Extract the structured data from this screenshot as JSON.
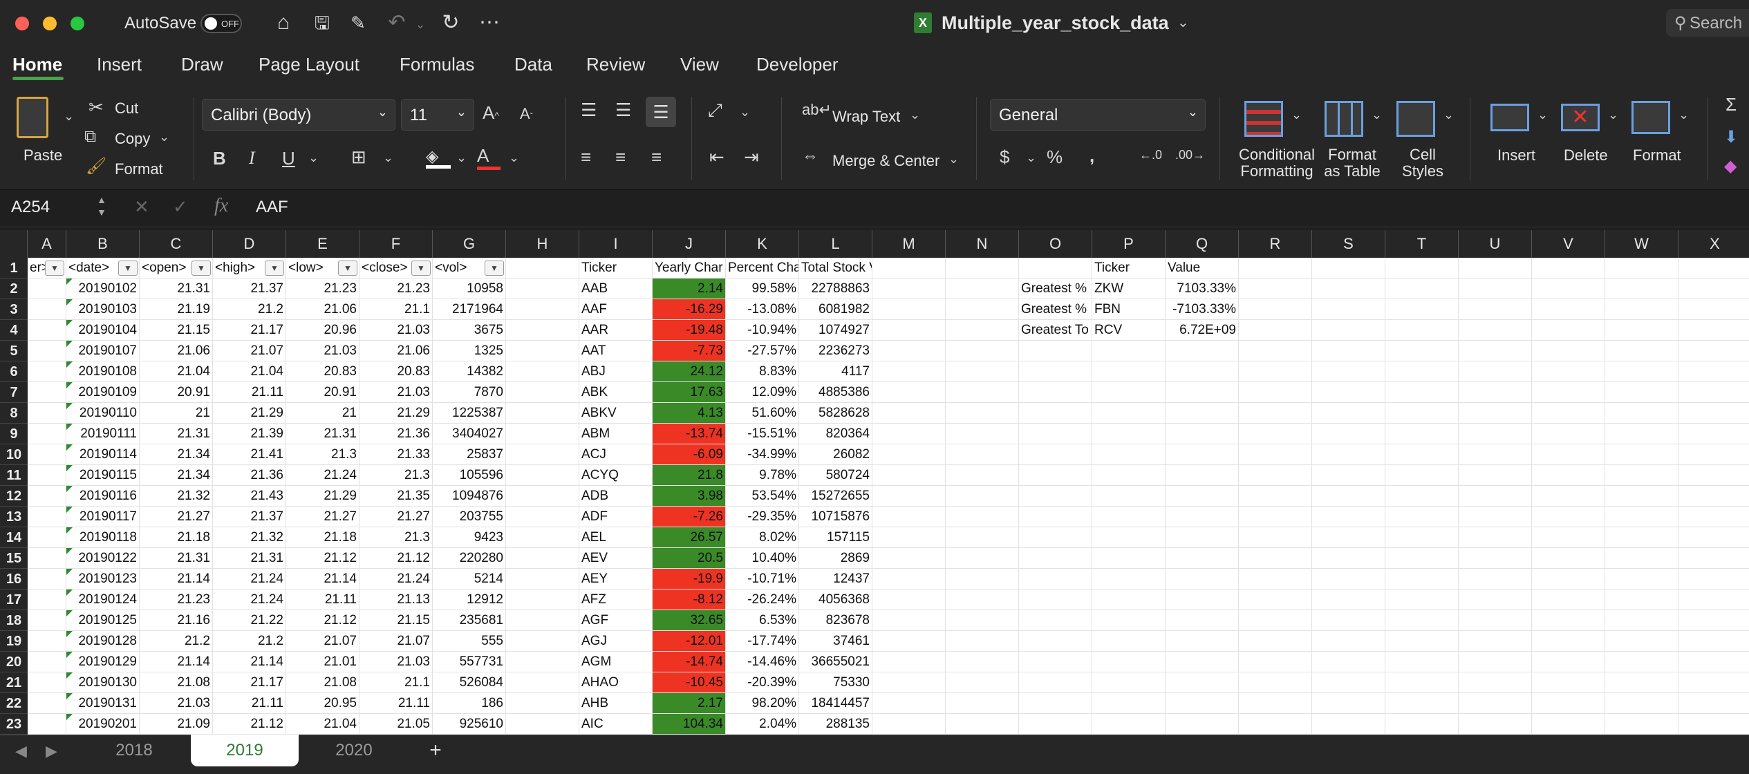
{
  "titlebar": {
    "autosave": "AutoSave",
    "toggle": "OFF",
    "doc_title": "Multiple_year_stock_data",
    "search": "Search",
    "icons": [
      "home-icon",
      "save-icon",
      "save-as-icon",
      "undo-icon",
      "redo-icon",
      "more-icon"
    ]
  },
  "tabs": [
    "Home",
    "Insert",
    "Draw",
    "Page Layout",
    "Formulas",
    "Data",
    "Review",
    "View",
    "Developer"
  ],
  "ribbon": {
    "paste": "Paste",
    "cut": "Cut",
    "copy": "Copy",
    "format": "Format",
    "font": "Calibri (Body)",
    "size": "11",
    "wrap": "Wrap Text",
    "merge": "Merge & Center",
    "numfmt": "General",
    "cond1": "Conditional",
    "cond2": "Formatting",
    "fat1": "Format",
    "fat2": "as Table",
    "cs1": "Cell",
    "cs2": "Styles",
    "insert": "Insert",
    "delete": "Delete",
    "fmt": "Format"
  },
  "formula": {
    "namebox": "A254",
    "fx": "fx",
    "value": "AAF"
  },
  "columns": [
    "A",
    "B",
    "C",
    "D",
    "E",
    "F",
    "G",
    "H",
    "I",
    "J",
    "K",
    "L",
    "M",
    "N",
    "O",
    "P",
    "Q",
    "R",
    "S",
    "T",
    "U",
    "V",
    "W",
    "X"
  ],
  "headers": {
    "A": "er>",
    "B": "<date>",
    "C": "<open>",
    "D": "<high>",
    "E": "<low>",
    "F": "<close>",
    "G": "<vol>",
    "I": "Ticker",
    "J": "Yearly Char",
    "K": "Percent Cha",
    "L": "Total Stock Volume",
    "P": "Ticker",
    "Q": "Value"
  },
  "rows": [
    {
      "b": "20190102",
      "c": "21.31",
      "d": "21.37",
      "e": "21.23",
      "f": "21.23",
      "g": "10958",
      "i": "AAB",
      "j": "2.14",
      "k": "99.58%",
      "l": "22788863",
      "o": "Greatest %",
      "p": "ZKW",
      "q": "7103.33%"
    },
    {
      "b": "20190103",
      "c": "21.19",
      "d": "21.2",
      "e": "21.06",
      "f": "21.1",
      "g": "2171964",
      "i": "AAF",
      "j": "-16.29",
      "k": "-13.08%",
      "l": "6081982",
      "o": "Greatest %",
      "p": "FBN",
      "q": "-7103.33%"
    },
    {
      "b": "20190104",
      "c": "21.15",
      "d": "21.17",
      "e": "20.96",
      "f": "21.03",
      "g": "3675",
      "i": "AAR",
      "j": "-19.48",
      "k": "-10.94%",
      "l": "1074927",
      "o": "Greatest To",
      "p": "RCV",
      "q": "6.72E+09"
    },
    {
      "b": "20190107",
      "c": "21.06",
      "d": "21.07",
      "e": "21.03",
      "f": "21.06",
      "g": "1325",
      "i": "AAT",
      "j": "-7.73",
      "k": "-27.57%",
      "l": "2236273"
    },
    {
      "b": "20190108",
      "c": "21.04",
      "d": "21.04",
      "e": "20.83",
      "f": "20.83",
      "g": "14382",
      "i": "ABJ",
      "j": "24.12",
      "k": "8.83%",
      "l": "4117"
    },
    {
      "b": "20190109",
      "c": "20.91",
      "d": "21.11",
      "e": "20.91",
      "f": "21.03",
      "g": "7870",
      "i": "ABK",
      "j": "17.63",
      "k": "12.09%",
      "l": "4885386"
    },
    {
      "b": "20190110",
      "c": "21",
      "d": "21.29",
      "e": "21",
      "f": "21.29",
      "g": "1225387",
      "i": "ABKV",
      "j": "4.13",
      "k": "51.60%",
      "l": "5828628"
    },
    {
      "b": "20190111",
      "c": "21.31",
      "d": "21.39",
      "e": "21.31",
      "f": "21.36",
      "g": "3404027",
      "i": "ABM",
      "j": "-13.74",
      "k": "-15.51%",
      "l": "820364"
    },
    {
      "b": "20190114",
      "c": "21.34",
      "d": "21.41",
      "e": "21.3",
      "f": "21.33",
      "g": "25837",
      "i": "ACJ",
      "j": "-6.09",
      "k": "-34.99%",
      "l": "26082"
    },
    {
      "b": "20190115",
      "c": "21.34",
      "d": "21.36",
      "e": "21.24",
      "f": "21.3",
      "g": "105596",
      "i": "ACYQ",
      "j": "21.8",
      "k": "9.78%",
      "l": "580724"
    },
    {
      "b": "20190116",
      "c": "21.32",
      "d": "21.43",
      "e": "21.29",
      "f": "21.35",
      "g": "1094876",
      "i": "ADB",
      "j": "3.98",
      "k": "53.54%",
      "l": "15272655"
    },
    {
      "b": "20190117",
      "c": "21.27",
      "d": "21.37",
      "e": "21.27",
      "f": "21.27",
      "g": "203755",
      "i": "ADF",
      "j": "-7.26",
      "k": "-29.35%",
      "l": "10715876"
    },
    {
      "b": "20190118",
      "c": "21.18",
      "d": "21.32",
      "e": "21.18",
      "f": "21.3",
      "g": "9423",
      "i": "AEL",
      "j": "26.57",
      "k": "8.02%",
      "l": "157115"
    },
    {
      "b": "20190122",
      "c": "21.31",
      "d": "21.31",
      "e": "21.12",
      "f": "21.12",
      "g": "220280",
      "i": "AEV",
      "j": "20.5",
      "k": "10.40%",
      "l": "2869"
    },
    {
      "b": "20190123",
      "c": "21.14",
      "d": "21.24",
      "e": "21.14",
      "f": "21.24",
      "g": "5214",
      "i": "AEY",
      "j": "-19.9",
      "k": "-10.71%",
      "l": "12437"
    },
    {
      "b": "20190124",
      "c": "21.23",
      "d": "21.24",
      "e": "21.11",
      "f": "21.13",
      "g": "12912",
      "i": "AFZ",
      "j": "-8.12",
      "k": "-26.24%",
      "l": "4056368"
    },
    {
      "b": "20190125",
      "c": "21.16",
      "d": "21.22",
      "e": "21.12",
      "f": "21.15",
      "g": "235681",
      "i": "AGF",
      "j": "32.65",
      "k": "6.53%",
      "l": "823678"
    },
    {
      "b": "20190128",
      "c": "21.2",
      "d": "21.2",
      "e": "21.07",
      "f": "21.07",
      "g": "555",
      "i": "AGJ",
      "j": "-12.01",
      "k": "-17.74%",
      "l": "37461"
    },
    {
      "b": "20190129",
      "c": "21.14",
      "d": "21.14",
      "e": "21.01",
      "f": "21.03",
      "g": "557731",
      "i": "AGM",
      "j": "-14.74",
      "k": "-14.46%",
      "l": "36655021"
    },
    {
      "b": "20190130",
      "c": "21.08",
      "d": "21.17",
      "e": "21.08",
      "f": "21.1",
      "g": "526084",
      "i": "AHAO",
      "j": "-10.45",
      "k": "-20.39%",
      "l": "75330"
    },
    {
      "b": "20190131",
      "c": "21.03",
      "d": "21.11",
      "e": "20.95",
      "f": "21.11",
      "g": "186",
      "i": "AHB",
      "j": "2.17",
      "k": "98.20%",
      "l": "18414457"
    },
    {
      "b": "20190201",
      "c": "21.09",
      "d": "21.12",
      "e": "21.04",
      "f": "21.05",
      "g": "925610",
      "i": "AIC",
      "j": "104.34",
      "k": "2.04%",
      "l": "288135"
    }
  ],
  "sheets": [
    "2018",
    "2019",
    "2020"
  ],
  "active_sheet": "2019",
  "colors": {
    "positive": "#3a8a28",
    "negative": "#ee3322",
    "accent": "#4aa24a"
  }
}
